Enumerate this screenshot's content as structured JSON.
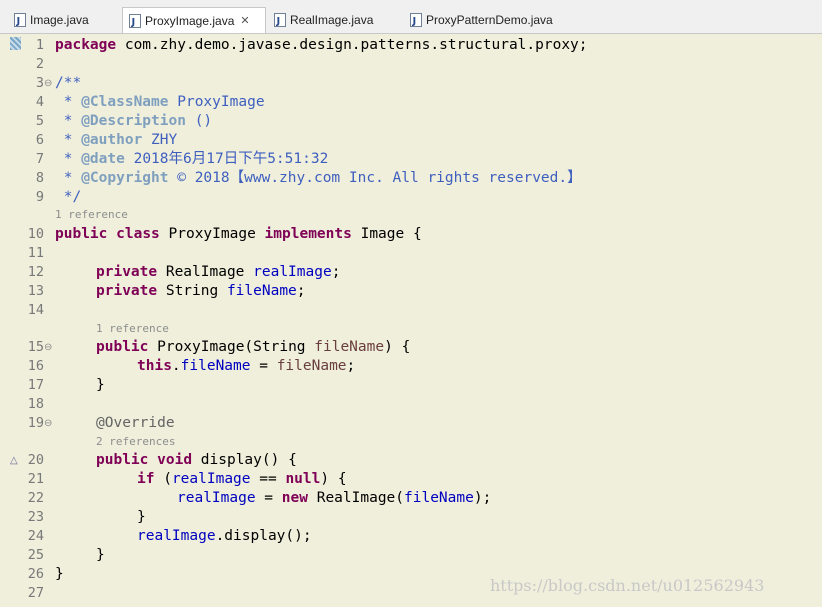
{
  "tabs": [
    {
      "label": "Image.java",
      "icon": "java-file-icon",
      "active": false
    },
    {
      "label": "ProxyImage.java",
      "icon": "java-file-icon",
      "active": true,
      "close": "✕"
    },
    {
      "label": "RealImage.java",
      "icon": "java-file-icon",
      "active": false
    },
    {
      "label": "ProxyPatternDemo.java",
      "icon": "java-file-icon",
      "active": false
    }
  ],
  "editor": {
    "line_numbers": [
      "1",
      "2",
      "3",
      "4",
      "5",
      "6",
      "7",
      "8",
      "9",
      "10",
      "11",
      "12",
      "13",
      "14",
      "15",
      "16",
      "17",
      "18",
      "19",
      "20",
      "21",
      "22",
      "23",
      "24",
      "25",
      "26",
      "27"
    ],
    "fold_markers": [
      "⊖",
      "⊖",
      "⊖"
    ],
    "override_marker": "△",
    "code": {
      "l1_kw": "package",
      "l1_rest": " com.zhy.demo.javase.design.patterns.structural.proxy;",
      "l3": "/**",
      "l4_a": " * ",
      "l4_tag": "@ClassName",
      "l4_b": " ProxyImage",
      "l5_a": " * ",
      "l5_tag": "@Description",
      "l5_b": " ()",
      "l6_a": " * ",
      "l6_tag": "@author",
      "l6_b": " ZHY",
      "l7_a": " * ",
      "l7_tag": "@date",
      "l7_b": " 2018年6月17日下午5:51:32",
      "l8_a": " * ",
      "l8_tag": "@Copyright",
      "l8_b": " © 2018【www.zhy.com Inc. All rights reserved.】",
      "l9": " */",
      "l10_k1": "public",
      "l10_k2": "class",
      "l10_name": " ProxyImage ",
      "l10_k3": "implements",
      "l10_rest": " Image {",
      "l12_kw": "private",
      "l12_type": " RealImage ",
      "l12_fld": "realImage",
      "l12_end": ";",
      "l13_kw": "private",
      "l13_type": " String ",
      "l13_fld": "fileName",
      "l13_end": ";",
      "l15_kw": "public",
      "l15_a": " ProxyImage(String ",
      "l15_par": "fileName",
      "l15_b": ") {",
      "l16_kw": "this",
      "l16_dot": ".",
      "l16_fld": "fileName",
      "l16_eq": " = ",
      "l16_par": "fileName",
      "l16_end": ";",
      "l17": "}",
      "l19": "@Override",
      "l20_k1": "public",
      "l20_k2": "void",
      "l20_rest": " display() {",
      "l21_kw": "if",
      "l21_a": " (",
      "l21_fld": "realImage",
      "l21_b": " == ",
      "l21_null": "null",
      "l21_c": ") {",
      "l22_fld1": "realImage",
      "l22_eq": " = ",
      "l22_new": "new",
      "l22_a": " RealImage(",
      "l22_fld2": "fileName",
      "l22_b": ");",
      "l23": "}",
      "l24_fld": "realImage",
      "l24_rest": ".display();",
      "l25": "}",
      "l26": "}"
    },
    "code_lens": [
      "1 reference",
      "1 reference",
      "2 references"
    ]
  },
  "watermark": "https://blog.csdn.net/u012562943"
}
